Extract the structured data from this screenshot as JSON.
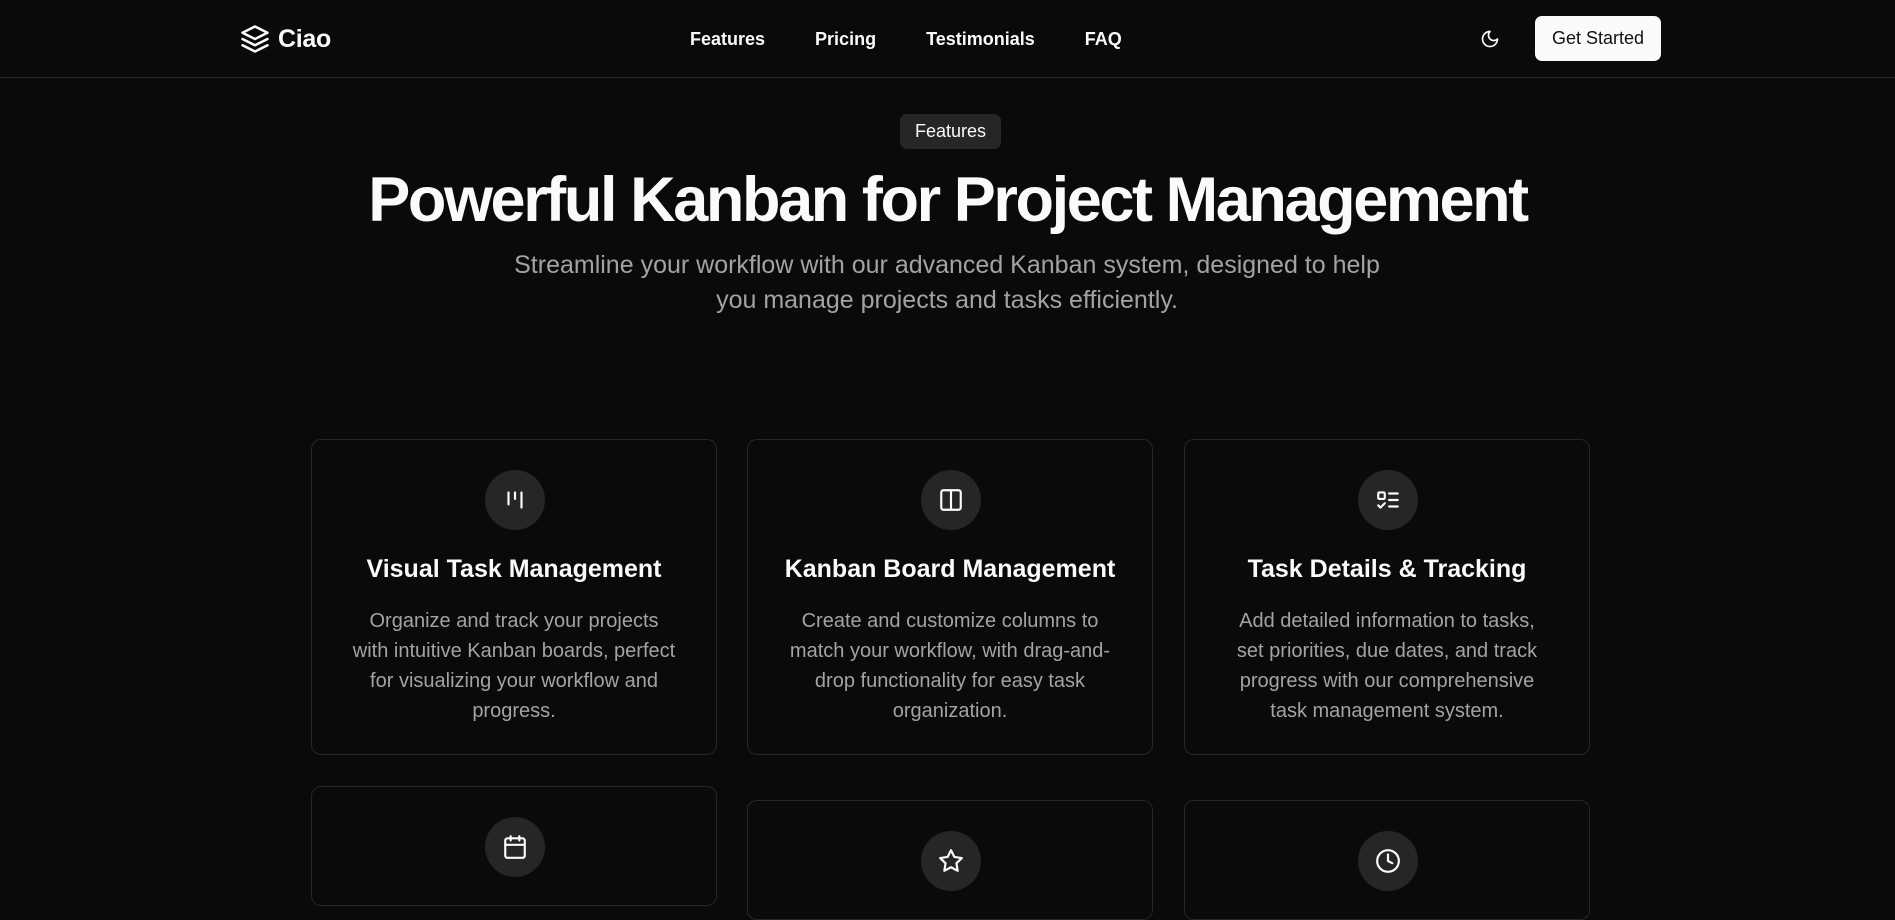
{
  "header": {
    "brand": "Ciao",
    "nav": [
      {
        "label": "Features"
      },
      {
        "label": "Pricing"
      },
      {
        "label": "Testimonials"
      },
      {
        "label": "FAQ"
      }
    ],
    "theme_icon": "moon-icon",
    "cta_label": "Get Started"
  },
  "hero": {
    "badge": "Features",
    "title": "Powerful Kanban for Project Management",
    "subtitle": "Streamline your workflow with our advanced Kanban system, designed to help you manage projects and tasks efficiently."
  },
  "features": [
    {
      "icon": "kanban-icon",
      "title": "Visual Task Management",
      "description": "Organize and track your projects with intuitive Kanban boards, perfect for visualizing your workflow and progress."
    },
    {
      "icon": "columns-icon",
      "title": "Kanban Board Management",
      "description": "Create and customize columns to match your workflow, with drag-and-drop functionality for easy task organization."
    },
    {
      "icon": "list-todo-icon",
      "title": "Task Details & Tracking",
      "description": "Add detailed information to tasks, set priorities, due dates, and track progress with our comprehensive task management system."
    },
    {
      "icon": "calendar-icon",
      "title": "",
      "description": ""
    },
    {
      "icon": "star-icon",
      "title": "",
      "description": ""
    },
    {
      "icon": "clock-icon",
      "title": "",
      "description": ""
    }
  ],
  "colors": {
    "background": "#0a0a0a",
    "foreground": "#fafafa",
    "muted": "#a3a3a3",
    "border": "#262626"
  }
}
